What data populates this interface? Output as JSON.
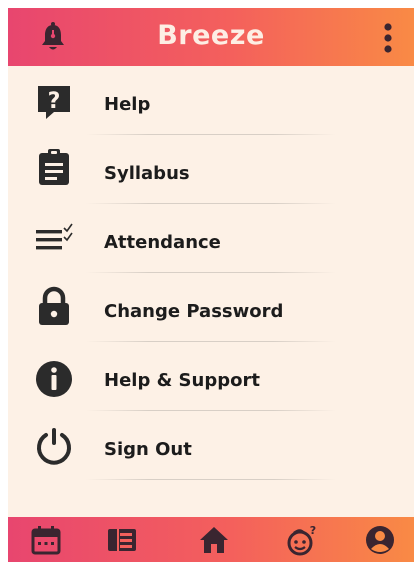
{
  "header": {
    "title": "Breeze",
    "left_icon": "bell-icon",
    "right_icon": "more-vertical-icon"
  },
  "menu": {
    "items": [
      {
        "label": "Help",
        "icon": "question-icon"
      },
      {
        "label": "Syllabus",
        "icon": "clipboard-icon"
      },
      {
        "label": "Attendance",
        "icon": "checklist-icon"
      },
      {
        "label": "Change Password",
        "icon": "lock-icon"
      },
      {
        "label": "Help & Support",
        "icon": "info-icon"
      },
      {
        "label": "Sign Out",
        "icon": "power-icon"
      }
    ]
  },
  "bottom_nav": {
    "items": [
      {
        "icon": "calendar-icon"
      },
      {
        "icon": "book-icon"
      },
      {
        "icon": "home-icon"
      },
      {
        "icon": "baby-question-icon"
      },
      {
        "icon": "profile-icon"
      }
    ]
  },
  "colors": {
    "header_gradient_start": "#e8466f",
    "header_gradient_end": "#f98a45",
    "background": "#fdf1e6",
    "icon_dark": "#2b2b2b",
    "header_text": "#fdeee4"
  }
}
